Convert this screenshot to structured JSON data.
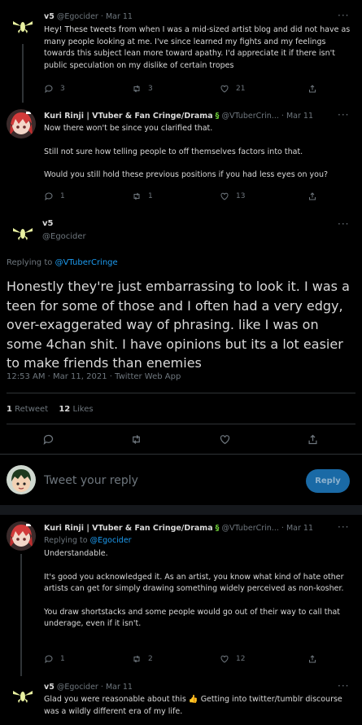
{
  "tweet1": {
    "display_name": "v5",
    "handle": "@Egocider",
    "sep": "·",
    "date": "Mar 11",
    "text": "Hey! These tweets from when I was a mid-sized artist blog and did not have as many people looking at me. I've since learned my fights and my feelings towards this subject lean more toward apathy. I'd appreciate it if there isn't public speculation on my dislike of certain tropes",
    "replies": "3",
    "retweets": "3",
    "likes": "21"
  },
  "tweet2": {
    "display_name": "Kuri Rinji | VTuber & Fan Cringe/Drama",
    "handle": "@VTuberCrin...",
    "sep": "·",
    "date": "Mar 11",
    "para1": "Now there won't be since you clarified that.",
    "para2": "Still not sure how telling people to off themselves factors into that.",
    "para3": "Would you still hold these previous positions if you had less eyes on you?",
    "replies": "1",
    "retweets": "1",
    "likes": "13"
  },
  "main": {
    "display_name": "v5",
    "handle": "@Egocider",
    "replying_prefix": "Replying to",
    "replying_to": "@VTuberCringe",
    "text": "Honestly they're just embarrassing to look it. I was a teen for some of those and I often had a very edgy, over-exaggerated way of phrasing. like I was on some 4chan shit. I have opinions but its a lot easier to make friends than enemies",
    "timestamp": "12:53 AM · Mar 11, 2021 · Twitter Web App",
    "retweet_count": "1",
    "retweet_label": "Retweet",
    "like_count": "12",
    "like_label": "Likes"
  },
  "compose": {
    "placeholder": "Tweet your reply",
    "button": "Reply"
  },
  "tweet3": {
    "display_name": "Kuri Rinji | VTuber & Fan Cringe/Drama",
    "handle": "@VTuberCrin...",
    "sep": "·",
    "date": "Mar 11",
    "replying_prefix": "Replying to",
    "replying_to": "@Egocider",
    "para1": "Understandable.",
    "para2": "It's good you acknowledged it. As an artist, you know what kind of hate other artists can get for simply drawing something widely perceived as non-kosher.",
    "para3": "You draw shortstacks and some people would go out of their way to call that underage, even if it isn't.",
    "replies": "1",
    "retweets": "2",
    "likes": "12"
  },
  "tweet4": {
    "display_name": "v5",
    "handle": "@Egocider",
    "sep": "·",
    "date": "Mar 11",
    "text_a": "Glad you were reasonable about this",
    "emoji": "👍",
    "text_b": " Getting into twitter/tumblr discourse was a wildly different era of my life."
  },
  "colors": {
    "background": "#000000",
    "accent": "#1d9bf0",
    "reply_button": "#1a6aa6",
    "muted": "#6e767d"
  }
}
